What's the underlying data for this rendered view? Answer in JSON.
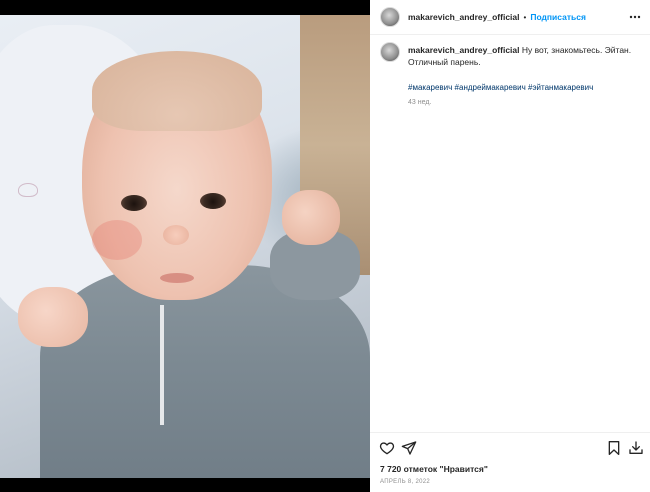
{
  "post": {
    "username": "makarevich_andrey_official",
    "header_separator": "•",
    "follow_label": "Подписаться",
    "more_icon": "more-horizontal-icon",
    "caption": {
      "username": "makarevich_andrey_official",
      "text": "Ну вот, знакомьтесь. Эйтан. Отличный парень.",
      "hashtags": [
        "#макаревич",
        "#андреймакаревич",
        "#эйтанмакаревич"
      ],
      "age": "43 нед."
    },
    "actions": {
      "like_icon": "heart-icon",
      "share_icon": "send-icon",
      "save_icon": "bookmark-icon",
      "download_icon": "download-icon"
    },
    "likes_text": "7 720 отметок \"Нравится\"",
    "date_text": "АПРЕЛЬ 8, 2022"
  },
  "colors": {
    "follow_blue": "#0095f6",
    "hashtag_blue": "#00376b",
    "muted_gray": "#8e8e8e",
    "text_dark": "#262626",
    "media_bg": "#000000"
  }
}
